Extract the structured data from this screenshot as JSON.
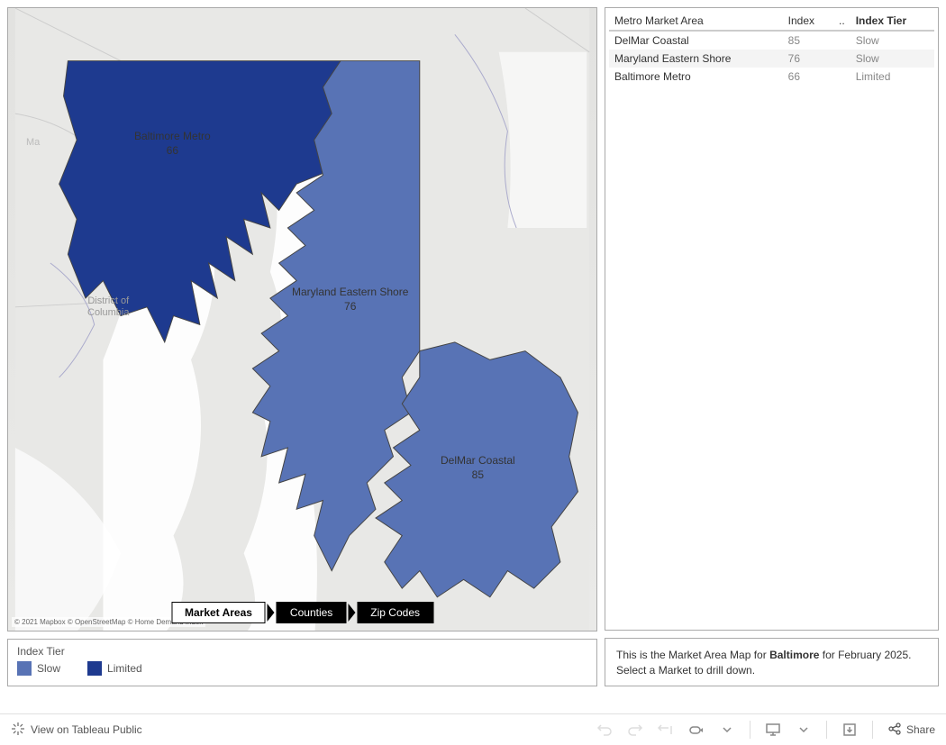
{
  "map": {
    "attribution": "© 2021 Mapbox © OpenStreetMap © Home Demand Index",
    "basemap_labels": {
      "dc": "District of\nColumbia",
      "ma": "Ma"
    },
    "regions": [
      {
        "name": "Baltimore Metro",
        "index": 66,
        "tier": "Limited",
        "color": "#1e3a8f",
        "label_x": 195,
        "label_y": 140
      },
      {
        "name": "Maryland Eastern Shore",
        "index": 76,
        "tier": "Slow",
        "color": "#5873b5",
        "label_x": 385,
        "label_y": 315
      },
      {
        "name": "DelMar Coastal",
        "index": 85,
        "tier": "Slow",
        "color": "#5873b5",
        "label_x": 525,
        "label_y": 500
      }
    ],
    "breadcrumb": {
      "items": [
        "Market Areas",
        "Counties",
        "Zip Codes"
      ],
      "active": 0
    }
  },
  "legend": {
    "title": "Index Tier",
    "items": [
      {
        "label": "Slow",
        "color": "#5873b5"
      },
      {
        "label": "Limited",
        "color": "#1e3a8f"
      }
    ]
  },
  "table": {
    "columns": [
      "Metro Market Area",
      "Index",
      "..",
      "Index Tier"
    ],
    "rows": [
      {
        "name": "DelMar Coastal",
        "index": 85,
        "blank": "",
        "tier": "Slow"
      },
      {
        "name": "Maryland Eastern Shore",
        "index": 76,
        "blank": "",
        "tier": "Slow"
      },
      {
        "name": "Baltimore Metro",
        "index": 66,
        "blank": "",
        "tier": "Limited"
      }
    ]
  },
  "caption": {
    "prefix": "This is the Market Area Map for ",
    "bold": "Baltimore",
    "suffix": " for February 2025. Select a Market to drill down."
  },
  "footer": {
    "view_label": "View on Tableau Public",
    "share_label": "Share"
  }
}
